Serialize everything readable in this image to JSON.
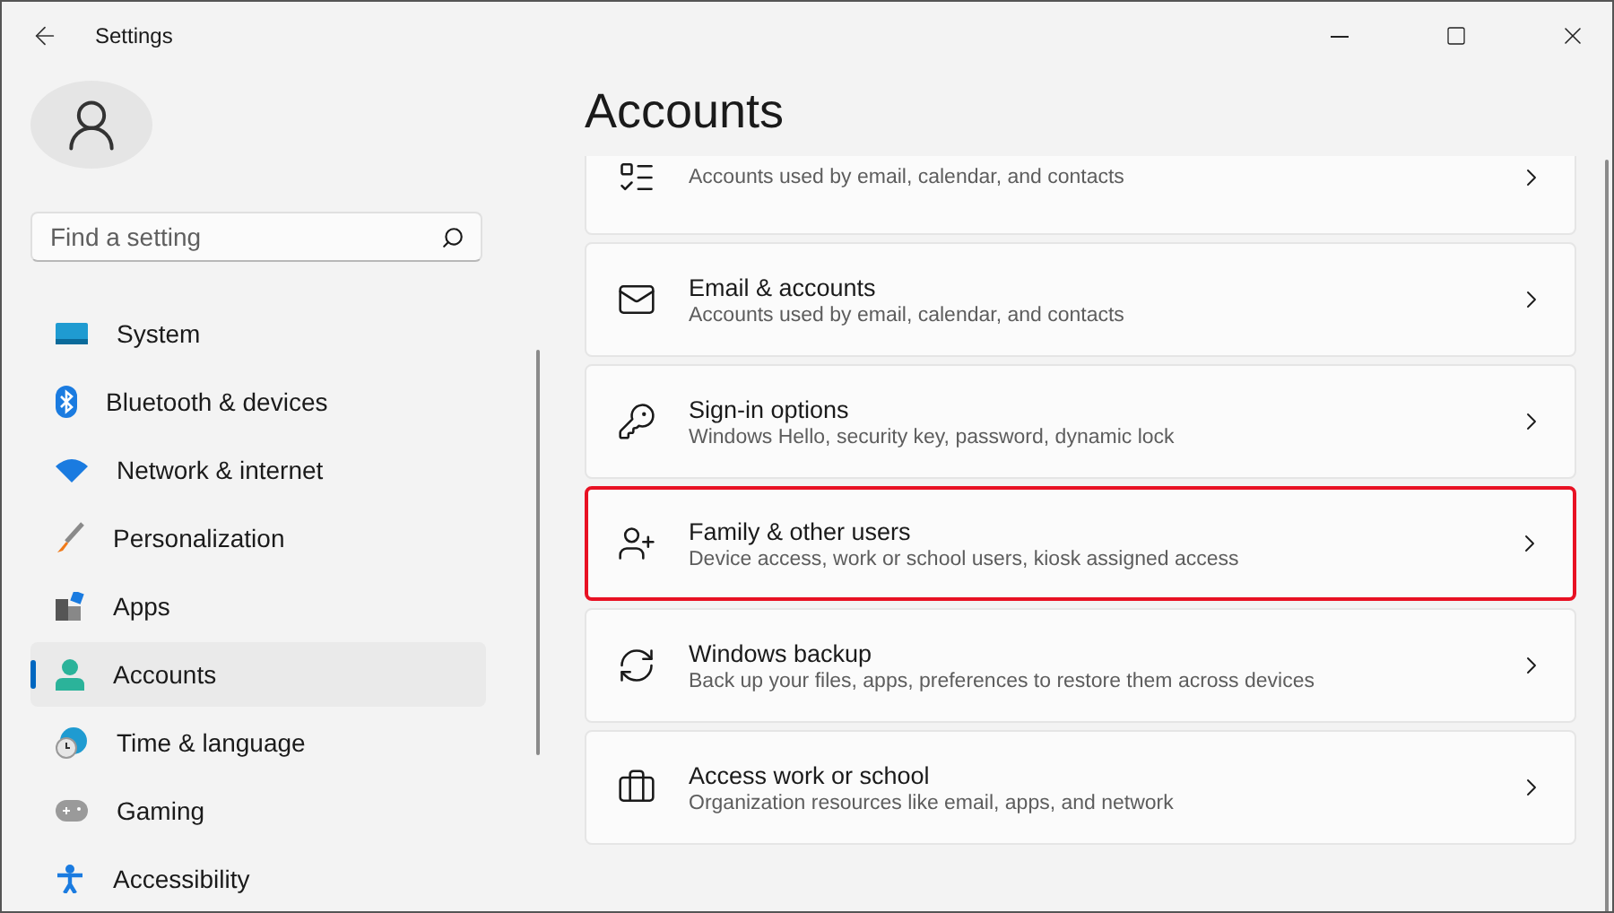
{
  "window": {
    "title": "Settings"
  },
  "search": {
    "placeholder": "Find a setting"
  },
  "sidebar": {
    "items": [
      {
        "label": "System",
        "selected": false
      },
      {
        "label": "Bluetooth & devices",
        "selected": false
      },
      {
        "label": "Network & internet",
        "selected": false
      },
      {
        "label": "Personalization",
        "selected": false
      },
      {
        "label": "Apps",
        "selected": false
      },
      {
        "label": "Accounts",
        "selected": true
      },
      {
        "label": "Time & language",
        "selected": false
      },
      {
        "label": "Gaming",
        "selected": false
      },
      {
        "label": "Accessibility",
        "selected": false
      }
    ]
  },
  "page": {
    "title": "Accounts"
  },
  "cards": [
    {
      "subtitle": "Accounts used by email, calendar, and contacts",
      "highlighted": false
    },
    {
      "title": "Email & accounts",
      "subtitle": "Accounts used by email, calendar, and contacts",
      "highlighted": false
    },
    {
      "title": "Sign-in options",
      "subtitle": "Windows Hello, security key, password, dynamic lock",
      "highlighted": false
    },
    {
      "title": "Family & other users",
      "subtitle": "Device access, work or school users, kiosk assigned access",
      "highlighted": true
    },
    {
      "title": "Windows backup",
      "subtitle": "Back up your files, apps, preferences to restore them across devices",
      "highlighted": false
    },
    {
      "title": "Access work or school",
      "subtitle": "Organization resources like email, apps, and network",
      "highlighted": false
    }
  ]
}
